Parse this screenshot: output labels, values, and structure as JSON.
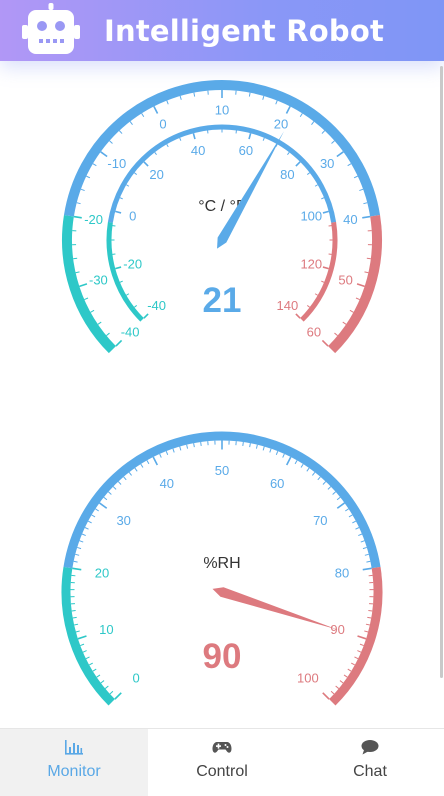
{
  "header": {
    "title": "Intelligent Robot",
    "icon": "robot-icon"
  },
  "colors": {
    "header_gradient": [
      "#b197f6",
      "#7f96f6"
    ],
    "gauge_blue": "#5aaae8",
    "gauge_teal": "#2ec8c8",
    "gauge_red": "#dd7a7f",
    "active_tab": "#5aa8e6"
  },
  "temperature_gauge": {
    "unit_label": "°C / °F",
    "value": 21,
    "celsius_min": -40,
    "celsius_max": 60,
    "celsius_ticks": [
      "-40",
      "-30",
      "-20",
      "-10",
      "0",
      "10",
      "20",
      "30",
      "40",
      "50",
      "60"
    ],
    "fahrenheit_min": -40,
    "fahrenheit_max": 140,
    "fahrenheit_ticks": [
      "-40",
      "-20",
      "0",
      "20",
      "40",
      "60",
      "80",
      "100",
      "120",
      "140"
    ]
  },
  "humidity_gauge": {
    "unit_label": "%RH",
    "value": 90,
    "min": 0,
    "max": 100,
    "ticks": [
      "0",
      "10",
      "20",
      "30",
      "40",
      "50",
      "60",
      "70",
      "80",
      "90",
      "100"
    ]
  },
  "nav": {
    "items": [
      {
        "label": "Monitor",
        "icon": "bar-chart-icon",
        "active": true
      },
      {
        "label": "Control",
        "icon": "gamepad-icon",
        "active": false
      },
      {
        "label": "Chat",
        "icon": "chat-bubble-icon",
        "active": false
      }
    ]
  }
}
